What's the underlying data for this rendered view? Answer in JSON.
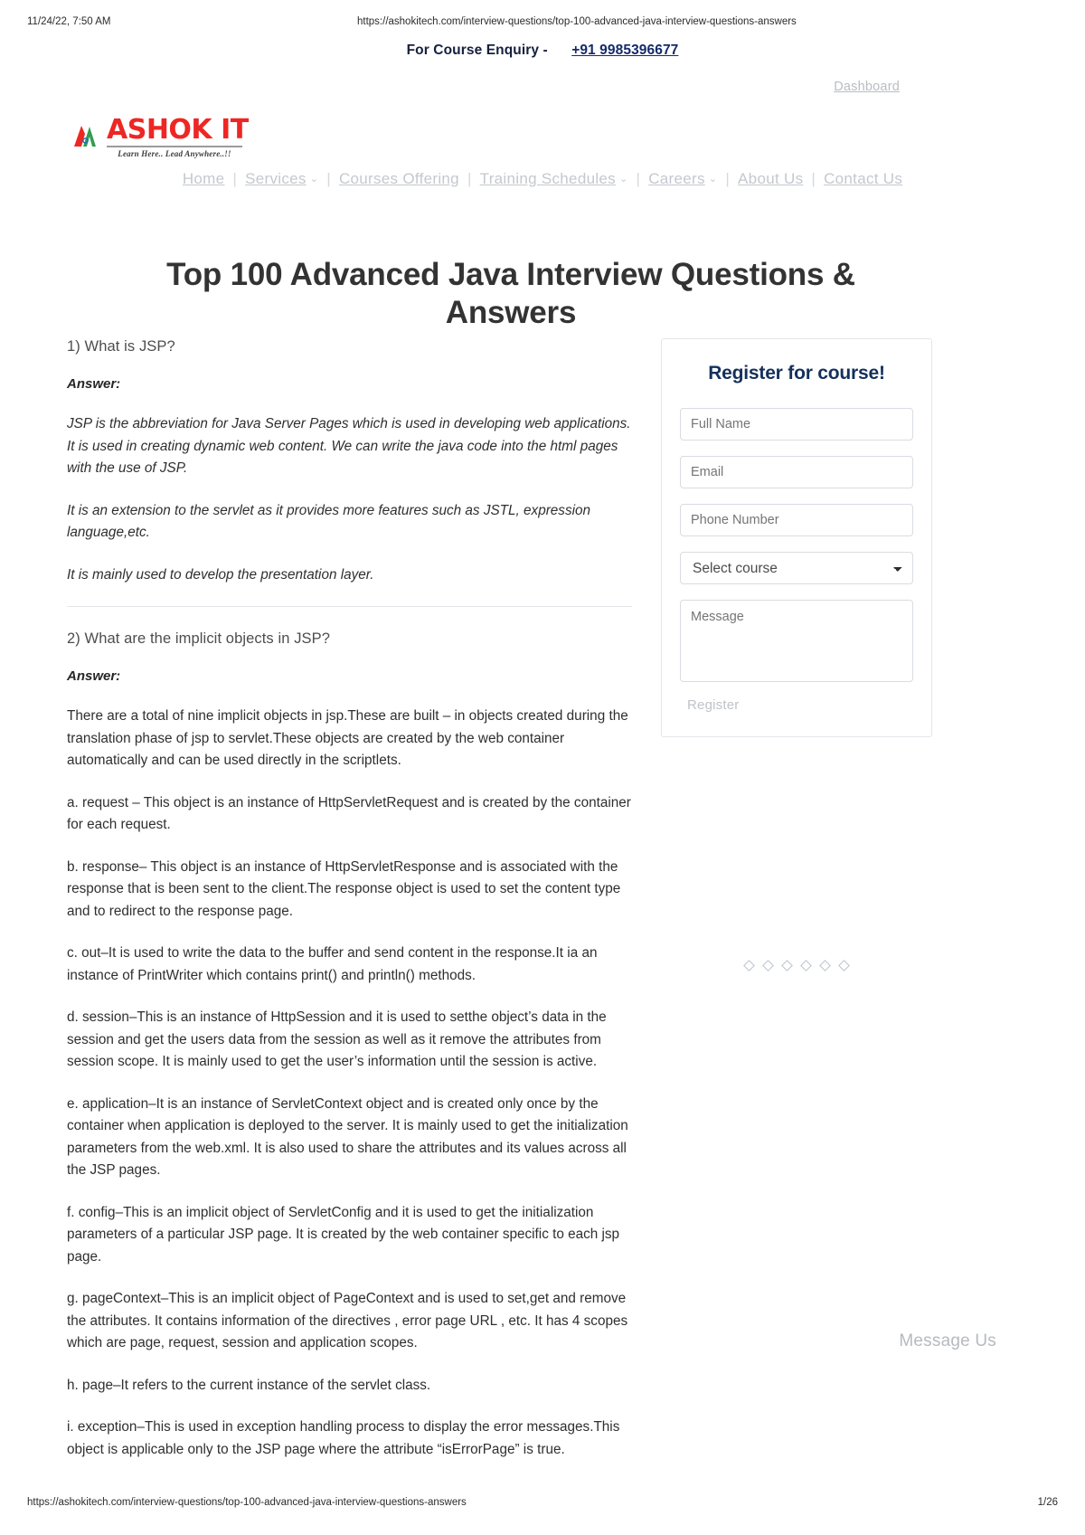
{
  "print_header": {
    "date": "11/24/22, 7:50 AM",
    "url": "https://ashokitech.com/interview-questions/top-100-advanced-java-interview-questions-answers"
  },
  "enquiry": {
    "label": "For Course Enquiry -",
    "phone": "+91 9985396677"
  },
  "topbar": {
    "dashboard_label": "Dashboard"
  },
  "logo": {
    "name": "ASHOK IT",
    "tagline": "Learn Here.. Lead Anywhere..!!"
  },
  "nav": {
    "items": [
      {
        "label": "Home",
        "caret": false
      },
      {
        "label": "Services",
        "caret": true
      },
      {
        "label": "Courses Offering",
        "caret": false
      },
      {
        "label": "Training Schedules",
        "caret": true
      },
      {
        "label": "Careers",
        "caret": true
      },
      {
        "label": "About Us",
        "caret": false
      },
      {
        "label": "Contact Us",
        "caret": false
      }
    ],
    "separator": "|",
    "caret_glyph": "⌄"
  },
  "page": {
    "title": "Top 100 Advanced Java Interview Questions & Answers"
  },
  "content": {
    "q1": {
      "question": "1) What is JSP?",
      "answer_label": "Answer:",
      "paragraphs": [
        "JSP is the abbreviation for Java Server Pages which is used in developing web applications. It is used in creating dynamic web content. We can write the java code into the html pages with the use of JSP.",
        "It is an extension to the servlet as it provides more features such as JSTL, expression language,etc.",
        "It is mainly used to develop the presentation layer."
      ]
    },
    "q2": {
      "question": "2) What are the implicit objects in JSP?",
      "answer_label": "Answer:",
      "paragraphs": [
        "There are a total of nine implicit objects in jsp.These are built – in objects created during the translation phase of jsp to servlet.These objects are created by the web container automatically and can be used directly in the scriptlets.",
        "a. request – This object is an instance of HttpServletRequest and is created by the container for each request.",
        "b. response– This object is an instance of HttpServletResponse and is associated with the response that is been sent to the client.The response object is used to set the content type and to redirect to the response page.",
        "c. out–It is used to write the data to the buffer and send content in the response.It ia an instance of PrintWriter which contains print() and println() methods.",
        "d. session–This is an instance of HttpSession and it is used to setthe object’s data in the session and get the users data from the session as well as it remove the attributes from session scope. It is mainly used to get the user’s information until the session is active.",
        "e. application–It is an instance of ServletContext object and is created only once by the container when application is deployed to the server. It is mainly used to get the initialization parameters from the web.xml. It is also used to share the attributes and its values across all the JSP pages.",
        "f. config–This is an implicit object of ServletConfig and it is used to get the initialization parameters of a particular JSP page. It is created by the web container specific to each jsp page.",
        "g. pageContext–This is an implicit object of PageContext and is used to set,get and remove the attributes. It contains information of the directives , error page URL , etc. It has 4 scopes which are page, request, session and application scopes.",
        "h. page–It refers to the current instance of the servlet class.",
        "i. exception–This is used in exception handling process to display the error messages.This object is applicable only to the JSP page where the attribute “isErrorPage” is true."
      ]
    }
  },
  "register_form": {
    "title": "Register for course!",
    "full_name_placeholder": "Full Name",
    "email_placeholder": "Email",
    "phone_placeholder": "Phone Number",
    "course_selected": "Select course",
    "message_placeholder": "Message",
    "submit_label": "Register"
  },
  "decor": {
    "diamond_count": 6
  },
  "chat_widget": {
    "label": "Message Us"
  },
  "print_footer": {
    "url": "https://ashokitech.com/interview-questions/top-100-advanced-java-interview-questions-answers",
    "page": "1/26"
  },
  "colors": {
    "brand_red": "#ed2724",
    "brand_green": "#2e9e4f",
    "register_title": "#14305c",
    "link_blue": "#142a6b",
    "nav_grey": "#c4c8ce"
  }
}
